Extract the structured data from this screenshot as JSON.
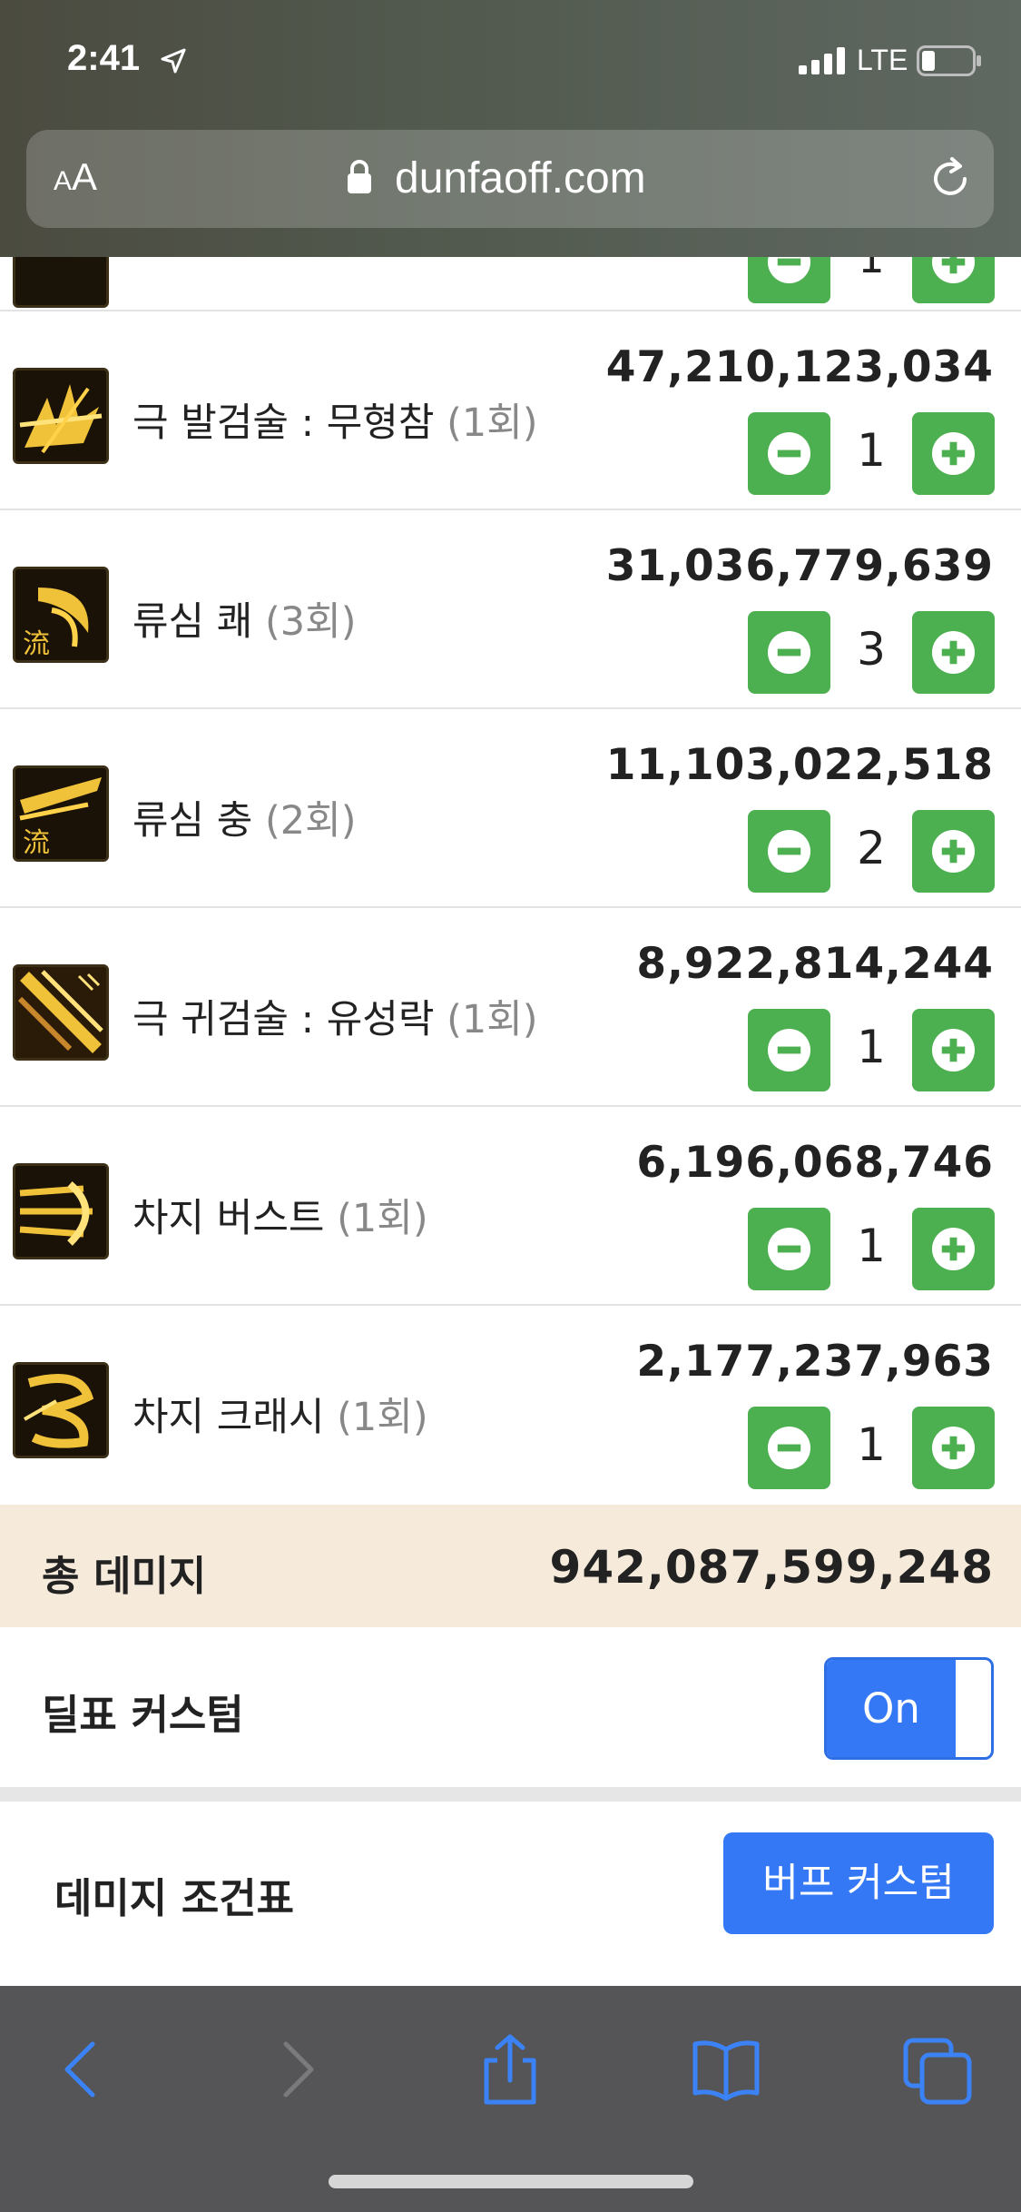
{
  "status_bar": {
    "time": "2:41",
    "network": "LTE"
  },
  "browser": {
    "aa_small": "A",
    "aa_big": "A",
    "url": "dunfaoff.com"
  },
  "skills": {
    "partial": {
      "quantity": "1"
    },
    "rows": [
      {
        "name": "극 발검술 : 무형참",
        "count": "(1회)",
        "damage": "47,210,123,034",
        "quantity": "1",
        "icon": "mu-hyeong-cham-icon"
      },
      {
        "name": "류심 쾌",
        "count": "(3회)",
        "damage": "31,036,779,639",
        "quantity": "3",
        "icon": "ryusim-kwae-icon"
      },
      {
        "name": "류심 충",
        "count": "(2회)",
        "damage": "11,103,022,518",
        "quantity": "2",
        "icon": "ryusim-chung-icon"
      },
      {
        "name": "극 귀검술 : 유성락",
        "count": "(1회)",
        "damage": "8,922,814,244",
        "quantity": "1",
        "icon": "yuseong-rak-icon"
      },
      {
        "name": "차지 버스트",
        "count": "(1회)",
        "damage": "6,196,068,746",
        "quantity": "1",
        "icon": "charge-burst-icon"
      },
      {
        "name": "차지 크래시",
        "count": "(1회)",
        "damage": "2,177,237,963",
        "quantity": "1",
        "icon": "charge-crash-icon"
      }
    ]
  },
  "summary": {
    "total_label": "총 데미지",
    "total_value": "942,087,599,248",
    "custom_label": "딜표 커스텀",
    "toggle_label": "On",
    "condition_label": "데미지 조건표",
    "buff_button": "버프 커스텀"
  },
  "colors": {
    "accent_green": "#4caf50",
    "accent_blue": "#3478f6",
    "total_bg": "#f6ebdb"
  }
}
